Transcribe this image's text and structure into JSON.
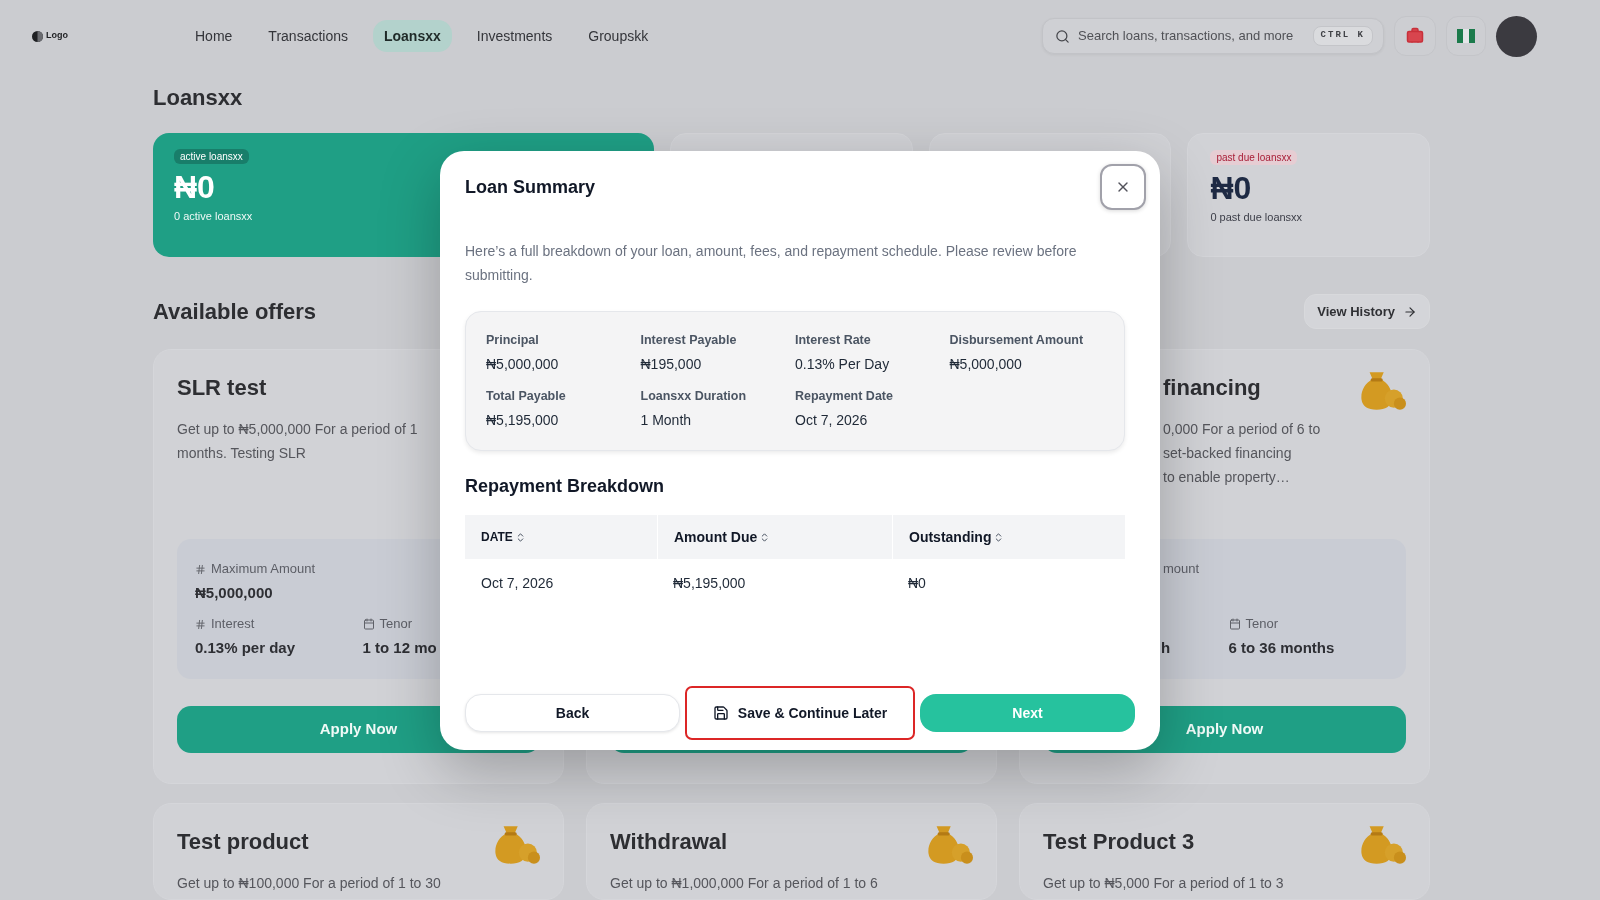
{
  "nav": {
    "logo": "Logo",
    "items": [
      {
        "label": "Home",
        "selected": false
      },
      {
        "label": "Transactions",
        "selected": false
      },
      {
        "label": "Loansxx",
        "selected": true
      },
      {
        "label": "Investments",
        "selected": false
      },
      {
        "label": "Groupskk",
        "selected": false
      }
    ],
    "search": {
      "placeholder": "Search loans, transactions, and more",
      "shortcut": "CTRL K"
    }
  },
  "page_title": "Loansxx",
  "stats": [
    {
      "kind": "highlight",
      "badge": "active loansxx",
      "amount": "₦0",
      "caption": "0 active loansxx"
    },
    {
      "kind": "covered"
    },
    {
      "kind": "covered"
    },
    {
      "kind": "alert",
      "badge": "past due loansxx",
      "amount": "₦0",
      "caption": "0 past due loansxx"
    }
  ],
  "offers_section": {
    "heading": "Available offers",
    "history_button": "View History",
    "cards": [
      {
        "kind": "cut_right",
        "title": "SLR test",
        "description_lines": [
          "Get up to ₦5,000,000 For a period of 1",
          "months. Testing SLR"
        ],
        "amount": {
          "label": "Maximum Amount",
          "value": "₦5,000,000"
        },
        "interest": {
          "label": "Interest",
          "value": "0.13% per day"
        },
        "tenor": {
          "label": "Tenor",
          "value": "1 to 12 mo"
        },
        "apply": "Apply Now"
      },
      {
        "kind": "covered"
      },
      {
        "kind": "cut_left",
        "title": "financing",
        "description_lines": [
          "0,000 For a period of 6 to",
          "set-backed financing",
          "to enable property…"
        ],
        "amount": {
          "label": "mount"
        },
        "interest": {
          "value": "h"
        },
        "tenor": {
          "label": "Tenor",
          "value": "6 to 36 months"
        },
        "apply": "Apply Now"
      },
      {
        "kind": "clipped",
        "title": "Test product",
        "description_lines": [
          "Get up to ₦100,000 For a period of 1 to 30"
        ]
      },
      {
        "kind": "clipped",
        "title": "Withdrawal",
        "description_lines": [
          "Get up to ₦1,000,000 For a period of 1 to 6"
        ]
      },
      {
        "kind": "clipped",
        "title": "Test Product 3",
        "description_lines": [
          "Get up to ₦5,000 For a period of 1 to 3"
        ]
      }
    ]
  },
  "modal": {
    "title": "Loan Summary",
    "description": "Here’s a full breakdown of your loan, amount, fees, and repayment schedule. Please review before submitting.",
    "summary": [
      {
        "label": "Principal",
        "value": "₦5,000,000"
      },
      {
        "label": "Interest Payable",
        "value": "₦195,000"
      },
      {
        "label": "Interest Rate",
        "value": "0.13% Per Day"
      },
      {
        "label": "Disbursement Amount",
        "value": "₦5,000,000"
      },
      {
        "label": "Total Payable",
        "value": "₦5,195,000"
      },
      {
        "label": "Loansxx Duration",
        "value": "1 Month"
      },
      {
        "label": "Repayment Date",
        "value": "Oct 7, 2026"
      }
    ],
    "breakdown": {
      "title": "Repayment Breakdown",
      "columns": [
        "DATE",
        "Amount Due",
        "Outstanding"
      ],
      "rows": [
        [
          "Oct 7, 2026",
          "₦5,195,000",
          "₦0"
        ]
      ]
    },
    "buttons": [
      {
        "kind": "secondary",
        "label": "Back"
      },
      {
        "kind": "save",
        "label": "Save & Continue Later"
      },
      {
        "kind": "primary",
        "label": "Next"
      }
    ]
  }
}
